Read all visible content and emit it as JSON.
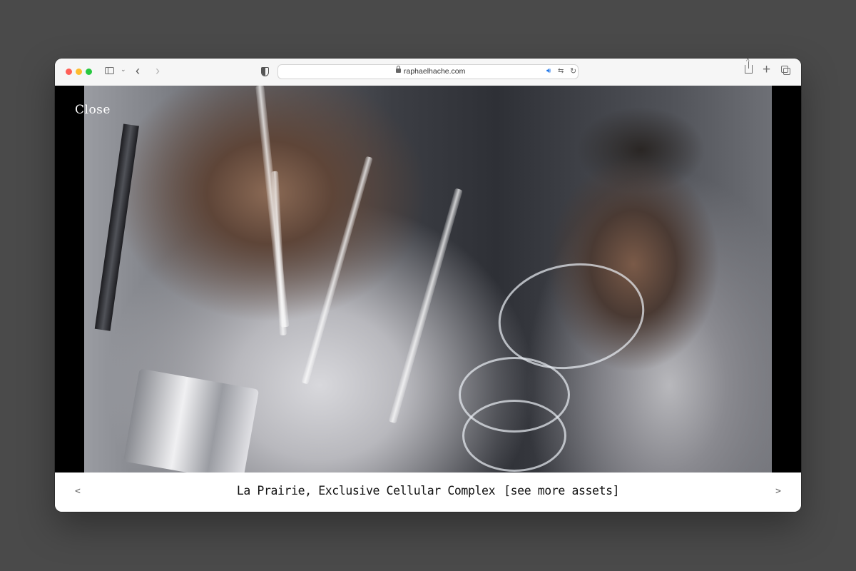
{
  "browser": {
    "url": "raphaelhache.com",
    "icons": {
      "sidebar": "sidebar-icon",
      "back": "chevron-left-icon",
      "forward": "chevron-right-icon",
      "privacy": "shield-icon",
      "lock": "lock-icon",
      "audio": "speaker-icon",
      "translate": "translate-icon",
      "reload": "reload-icon",
      "share": "share-icon",
      "new_tab": "plus-icon",
      "tab_overview": "tabs-icon"
    }
  },
  "viewer": {
    "close_label": "Close",
    "image_subject": "lab-scene-with-glass-pipettes"
  },
  "caption": {
    "prev_label": "<",
    "next_label": ">",
    "title": "La Prairie, Exclusive Cellular Complex",
    "more_label": "[see more assets]"
  },
  "colors": {
    "desktop": "#4a4a4a",
    "toolbar": "#f6f6f6",
    "viewer_bg": "#000000",
    "caption_bg": "#ffffff",
    "caption_text": "#111111"
  }
}
